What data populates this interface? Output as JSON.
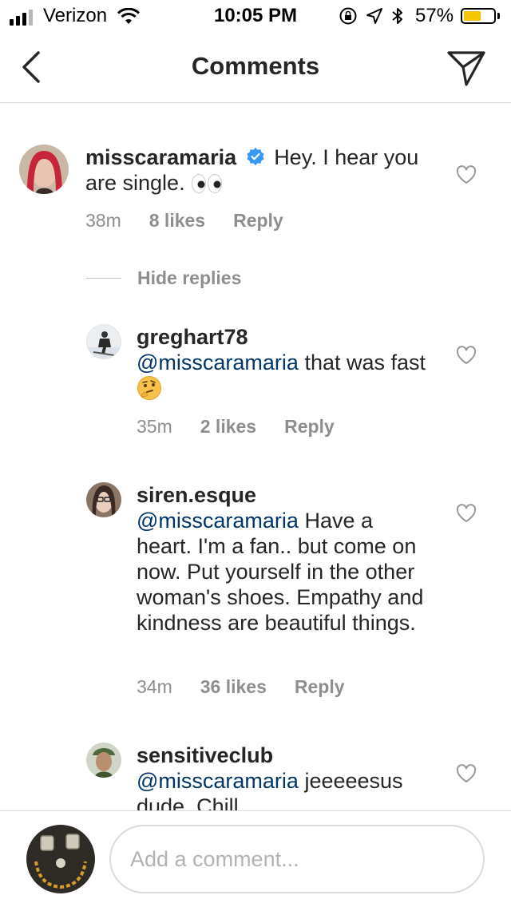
{
  "status_bar": {
    "carrier": "Verizon",
    "time": "10:05 PM",
    "battery_percent": "57%",
    "battery_level": 0.57,
    "icons": [
      "signal-icon",
      "wifi-icon",
      "rotation-lock-icon",
      "location-icon",
      "bluetooth-icon",
      "battery-icon"
    ]
  },
  "nav": {
    "title": "Comments",
    "back_icon": "chevron-left-icon",
    "send_icon": "direct-send-icon"
  },
  "comments": [
    {
      "username": "misscaramaria",
      "verified": true,
      "text": "Hey. I hear you are single.",
      "emoji": "👀",
      "time": "38m",
      "likes": "8 likes",
      "reply_label": "Reply"
    }
  ],
  "hide_replies_label": "Hide replies",
  "replies": [
    {
      "username": "greghart78",
      "mention": "@misscaramaria",
      "text": "that was fast",
      "emoji": "🤔",
      "time": "35m",
      "likes": "2 likes",
      "reply_label": "Reply"
    },
    {
      "username": "siren.esque",
      "mention": "@misscaramaria",
      "text": "Have a heart. I'm a fan.. but come on now. Put yourself in the other woman's shoes. Empathy and kindness are beautiful things.",
      "time": "34m",
      "likes": "36 likes",
      "reply_label": "Reply"
    },
    {
      "username": "sensitiveclub",
      "mention": "@misscaramaria",
      "text": "jeeeeesus dude. Chill"
    }
  ],
  "composer": {
    "placeholder": "Add a comment..."
  },
  "colors": {
    "text": "#262626",
    "meta": "#8e8e8e",
    "mention": "#003569",
    "verified": "#3897f0",
    "battery": "#f6c400",
    "divider": "#dbdbdb"
  }
}
